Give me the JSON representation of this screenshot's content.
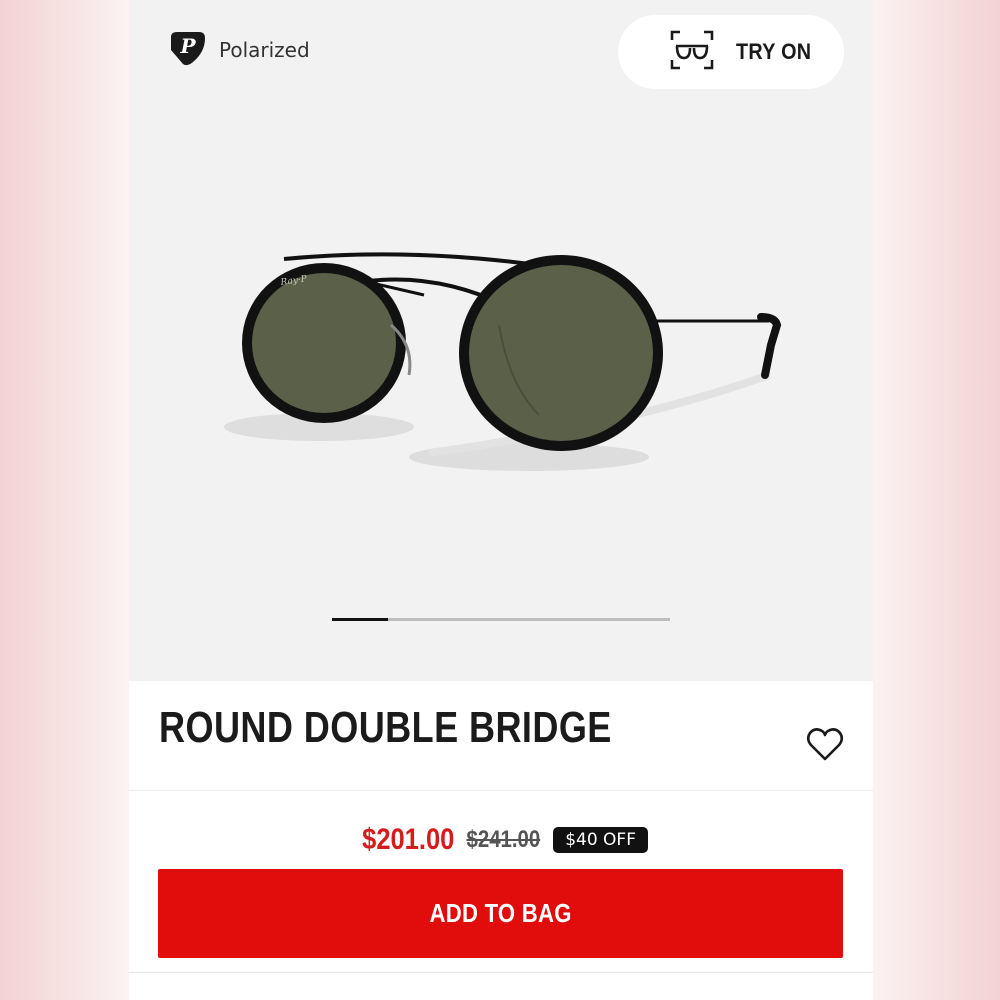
{
  "badge": {
    "label": "Polarized",
    "icon": "polarized-p-icon"
  },
  "try_on": {
    "label": "TRY ON",
    "icon": "try-on-glasses-icon"
  },
  "gallery": {
    "slide_count": 6,
    "active_index": 0,
    "image_alt": "Round Double Bridge sunglasses, black frame, green polarized lenses"
  },
  "product": {
    "title": "ROUND DOUBLE BRIDGE",
    "wishlist_icon": "heart-icon"
  },
  "pricing": {
    "current": "$201.00",
    "original": "$241.00",
    "discount": "$40 OFF"
  },
  "cta": {
    "add_to_bag": "ADD TO BAG"
  },
  "colors": {
    "accent_red": "#e10d0d",
    "price_red": "#d41c1c",
    "badge_black": "#111111",
    "gallery_bg": "#f2f2f2"
  }
}
